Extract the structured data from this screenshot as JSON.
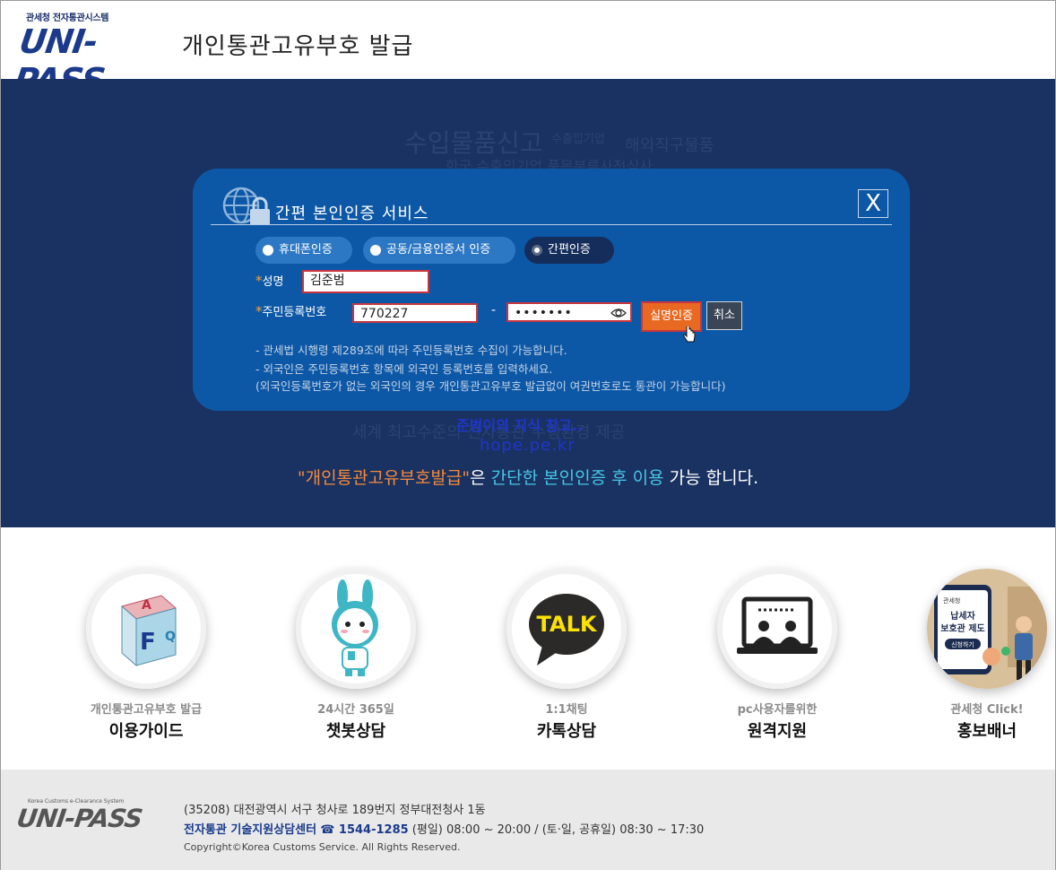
{
  "header": {
    "logo_small": "관세청 전자통관시스템",
    "logo_main": "UNI-PASS",
    "title": "개인통관고유부호 발급"
  },
  "hero": {
    "bg_words": [
      "수입물품신고",
      "수출입기업",
      "해외직구물품",
      "한국 수출입기업 품목분류사전심사",
      "세계 최고수준의 전자통관 수행환경 제공"
    ],
    "watermark_1": "준범이의 지식 창고..",
    "watermark_2": "hope.pe.kr",
    "notice_part1": "\"개인통관고유부호발급\"",
    "notice_part2": "은 ",
    "notice_part3": "간단한 본인인증 후 이용",
    "notice_part4": " 가능 합니다."
  },
  "modal": {
    "title": "간편 본인인증 서비스",
    "close": "X",
    "tabs": [
      {
        "label": "휴대폰인증"
      },
      {
        "label": "공동/금융인증서 인증"
      },
      {
        "label": "간편인증"
      }
    ],
    "name_label": "성명",
    "name_value": "김준범",
    "rrn_label": "주민등록번호",
    "rrn_front": "770227",
    "rrn_back": "•••••••",
    "dash": "-",
    "verify_button": "실명인증",
    "cancel_button": "취소",
    "info_1": "- 관세법 시행령 제289조에 따라 주민등록번호 수집이 가능합니다.",
    "info_2": "- 외국인은 주민등록번호 항목에 외국인 등록번호를 입력하세요.",
    "info_3": "(외국인등록번호가 없는 외국인의 경우 개인통관고유부호 발급없이 여권번호로도 통관이 가능합니다)"
  },
  "services": [
    {
      "sub": "개인통관고유부호 발급",
      "main": "이용가이드",
      "icon": "faq-cube-icon"
    },
    {
      "sub": "24시간 365일",
      "main": "챗봇상담",
      "icon": "chatbot-rabbit-icon"
    },
    {
      "sub": "1:1채팅",
      "main": "카톡상담",
      "icon": "talk-bubble-icon"
    },
    {
      "sub": "pc사용자를위한",
      "main": "원격지원",
      "icon": "remote-support-icon"
    },
    {
      "sub": "관세청 Click!",
      "main": "홍보배너",
      "icon": "promo-banner-icon"
    }
  ],
  "banner_text": {
    "line1": "관세청",
    "line2": "납세자",
    "line3": "보호관 제도",
    "button": "신청하기"
  },
  "footer": {
    "logo_small": "Korea Customs e-Clearance System",
    "logo": "UNI-PASS",
    "address": "(35208) 대전광역시 서구 청사로 189번지 정부대전청사 1동",
    "center": "전자통관 기술지원상담센터",
    "phone": "☎ 1544-1285",
    "hours": " (평일) 08:00 ~ 20:00 / (토·일, 공휴일) 08:30 ~ 17:30",
    "copyright": "Copyright©Korea Customs Service. All Rights Reserved."
  },
  "colors": {
    "hero_bg": "#1a3261",
    "modal_bg": "#0d58a6",
    "accent_orange": "#e86a22",
    "accent_cyan": "#47c6e6",
    "error_border": "#c9353e"
  }
}
